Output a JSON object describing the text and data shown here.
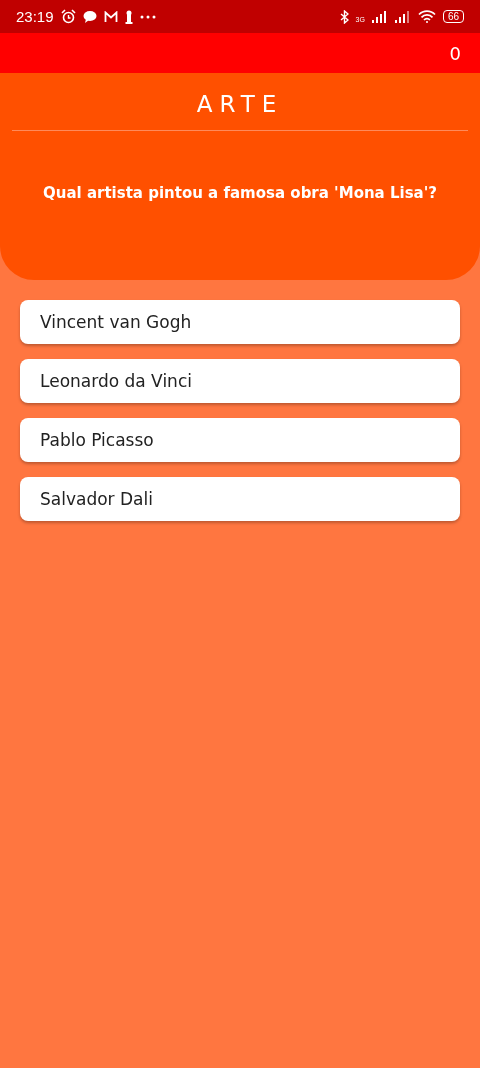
{
  "status_bar": {
    "time": "23:19",
    "network": "3G",
    "battery": "66"
  },
  "score": "0",
  "category": "ARTE",
  "question": "Qual artista pintou a famosa obra 'Mona Lisa'?",
  "answers": [
    {
      "label": "Vincent van Gogh"
    },
    {
      "label": "Leonardo da Vinci"
    },
    {
      "label": "Pablo Picasso"
    },
    {
      "label": "Salvador Dali"
    }
  ]
}
